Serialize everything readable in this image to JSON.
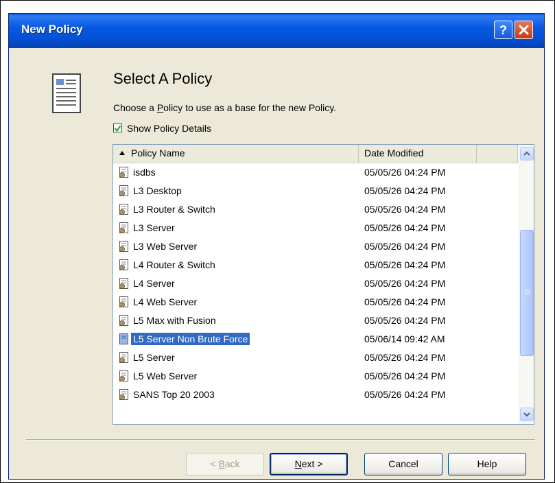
{
  "window": {
    "title": "New Policy"
  },
  "header": {
    "heading": "Select A Policy",
    "instruction_pre": "Choose a ",
    "instruction_mnemonic": "P",
    "instruction_post": "olicy to use as a base for the new Policy.",
    "show_details_label": "Show Policy Details",
    "show_details_checked": true
  },
  "listview": {
    "columns": [
      "Policy Name",
      "Date Modified"
    ],
    "sort_indicator": "ascending",
    "rows": [
      {
        "name": "isdbs",
        "date": "05/05/26 04:24 PM"
      },
      {
        "name": "L3 Desktop",
        "date": "05/05/26 04:24 PM"
      },
      {
        "name": "L3 Router & Switch",
        "date": "05/05/26 04:24 PM"
      },
      {
        "name": "L3 Server",
        "date": "05/05/26 04:24 PM"
      },
      {
        "name": "L3 Web Server",
        "date": "05/05/26 04:24 PM"
      },
      {
        "name": "L4 Router & Switch",
        "date": "05/05/26 04:24 PM"
      },
      {
        "name": "L4 Server",
        "date": "05/05/26 04:24 PM"
      },
      {
        "name": "L4 Web Server",
        "date": "05/05/26 04:24 PM"
      },
      {
        "name": "L5 Max with Fusion",
        "date": "05/05/26 04:24 PM"
      },
      {
        "name": "L5 Server Non Brute Force",
        "date": "05/06/14 09:42 AM",
        "selected": true
      },
      {
        "name": "L5 Server",
        "date": "05/05/26 04:24 PM"
      },
      {
        "name": "L5 Web Server",
        "date": "05/05/26 04:24 PM"
      },
      {
        "name": "SANS Top 20 2003",
        "date": "05/05/26 04:24 PM"
      }
    ]
  },
  "buttons": {
    "back_pre": "< ",
    "back_mnemonic": "B",
    "back_post": "ack",
    "next_mnemonic": "N",
    "next_post": "ext >",
    "cancel": "Cancel",
    "help": "Help"
  },
  "colors": {
    "titlebar": "#0452d8",
    "selection": "#316ac5",
    "dialog_bg": "#ece9d8"
  },
  "icons": {
    "title_help": "question-icon",
    "title_close": "close-icon",
    "wizard": "document-icon",
    "row": "policy-file-icon"
  }
}
